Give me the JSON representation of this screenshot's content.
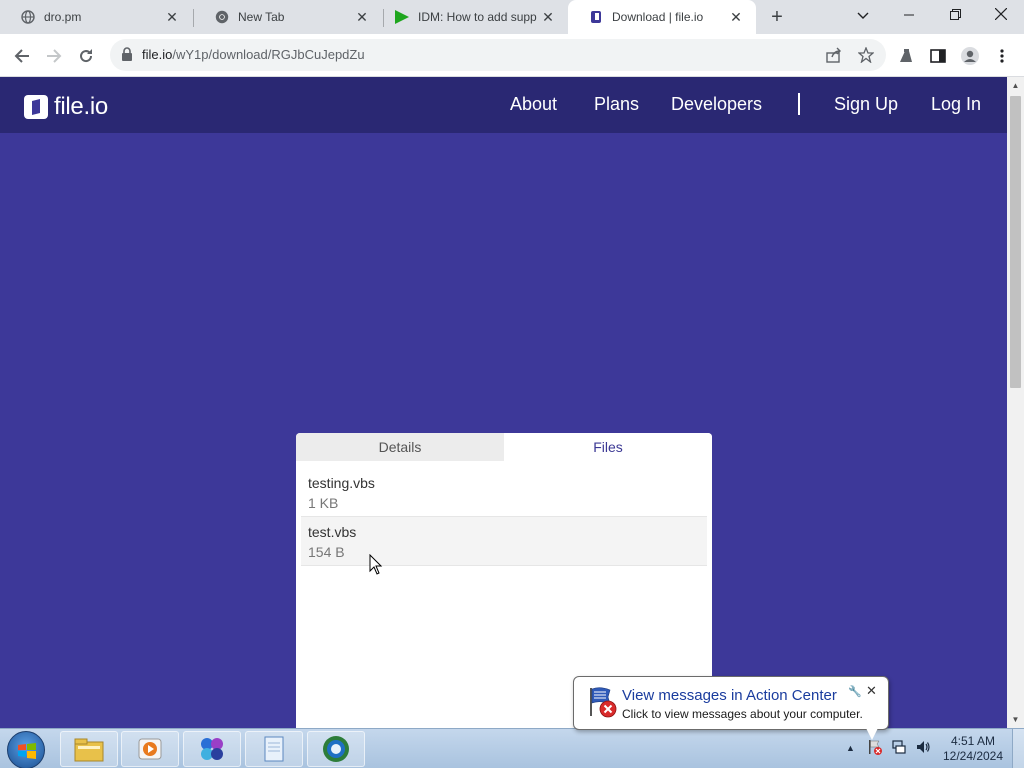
{
  "browser": {
    "tabs": [
      {
        "title": "dro.pm",
        "icon": "globe-icon",
        "active": false
      },
      {
        "title": "New Tab",
        "icon": "chrome-icon",
        "active": false
      },
      {
        "title": "IDM: How to add supp",
        "icon": "idm-play-icon",
        "active": false
      },
      {
        "title": "Download | file.io",
        "icon": "fileio-icon",
        "active": true
      }
    ],
    "address": {
      "host": "file.io",
      "path": "/wY1p/download/RGJbCuJepdZu"
    }
  },
  "site": {
    "logo_text": "file.io",
    "nav": {
      "about": "About",
      "plans": "Plans",
      "developers": "Developers",
      "sign_up": "Sign Up",
      "log_in": "Log In"
    },
    "colors": {
      "background": "#3d3899",
      "navbar": "#2a2873",
      "accent": "#3b3894"
    }
  },
  "download_card": {
    "tabs": {
      "details": "Details",
      "files": "Files"
    },
    "active_tab": "Files",
    "files": [
      {
        "name": "testing.vbs",
        "size": "1 KB"
      },
      {
        "name": "test.vbs",
        "size": "154 B"
      }
    ]
  },
  "notification": {
    "title": "View messages in Action Center",
    "text": "Click to view messages about your computer."
  },
  "taskbar": {
    "apps": [
      "file-explorer-icon",
      "media-player-icon",
      "app-icon",
      "notepad-icon",
      "browser-icon"
    ],
    "time": "4:51 AM",
    "date": "12/24/2024"
  }
}
